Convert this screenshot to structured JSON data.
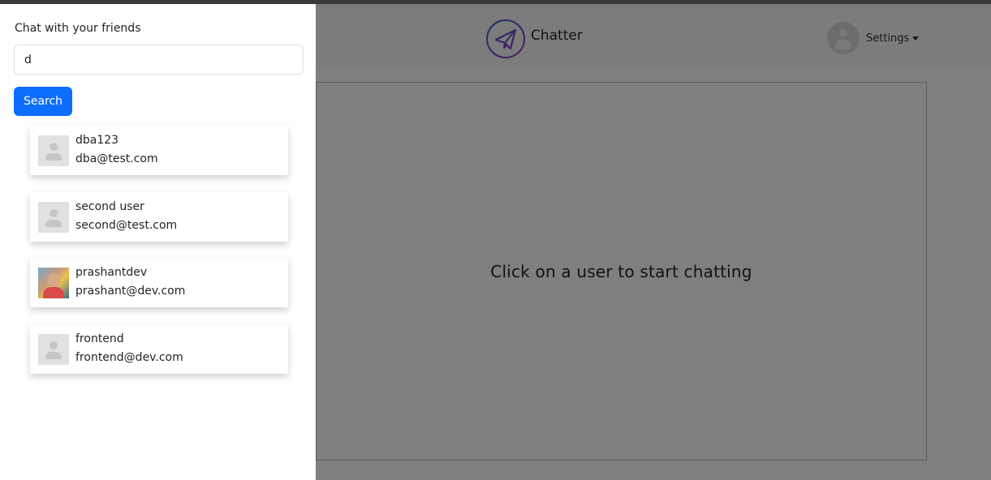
{
  "panel": {
    "title": "Chat with your friends",
    "search_value": "d",
    "search_button": "Search"
  },
  "users": [
    {
      "username": "dba123",
      "email": "dba@test.com",
      "avatar": "default-avatar-icon"
    },
    {
      "username": "second user",
      "email": "second@test.com",
      "avatar": "default-avatar-icon"
    },
    {
      "username": "prashantdev",
      "email": "prashant@dev.com",
      "avatar": "photo-avatar"
    },
    {
      "username": "frontend",
      "email": "frontend@dev.com",
      "avatar": "default-avatar-icon"
    }
  ],
  "navbar": {
    "brand": "Chatter",
    "settings_label": "Settings"
  },
  "chat": {
    "prompt": "Click on a user to start chatting"
  },
  "colors": {
    "primary": "#0d6efd",
    "navbar_bg": "#f8f9fa",
    "backdrop": "rgba(0,0,0,0.5)"
  }
}
